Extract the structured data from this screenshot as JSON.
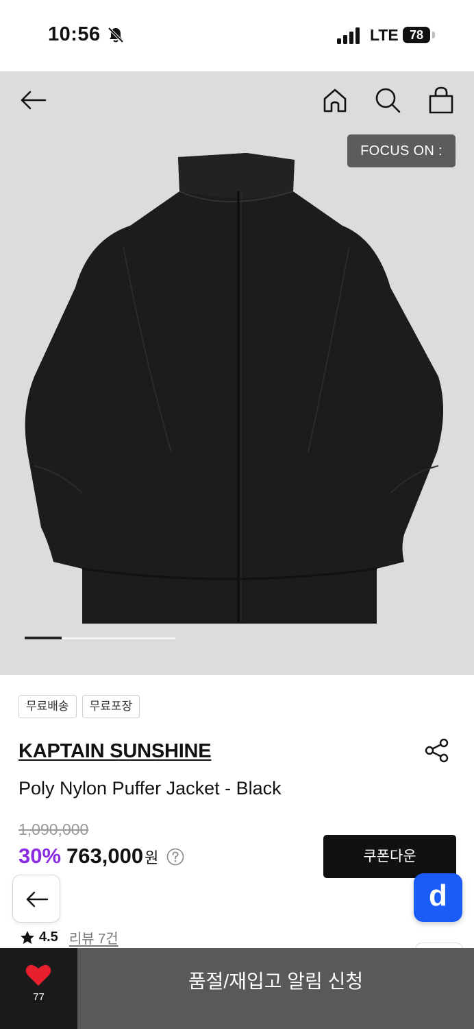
{
  "status_bar": {
    "time": "10:56",
    "network": "LTE",
    "battery": "78"
  },
  "hero": {
    "focus_badge": "FOCUS ON :",
    "image_alt": "black-puffer-jacket"
  },
  "tags": [
    "무료배송",
    "무료포장"
  ],
  "product": {
    "brand": "KAPTAIN SUNSHINE",
    "name": "Poly Nylon Puffer Jacket - Black",
    "original_price": "1,090,000",
    "discount": "30%",
    "sale_price": "763,000",
    "currency": "원",
    "coupon_label": "쿠폰다운"
  },
  "app_button": {
    "label": "d"
  },
  "rating": {
    "value": "4.5",
    "review_label": "리뷰 7건"
  },
  "bottom_bar": {
    "like_count": "77",
    "restock_label": "품절/재입고 알림 신청"
  },
  "colors": {
    "discount": "#8a2be2",
    "hero_bg": "#dcdcdc",
    "heart": "#e8202e",
    "app_button": "#1a5cf5",
    "restock_bg": "#595959"
  }
}
